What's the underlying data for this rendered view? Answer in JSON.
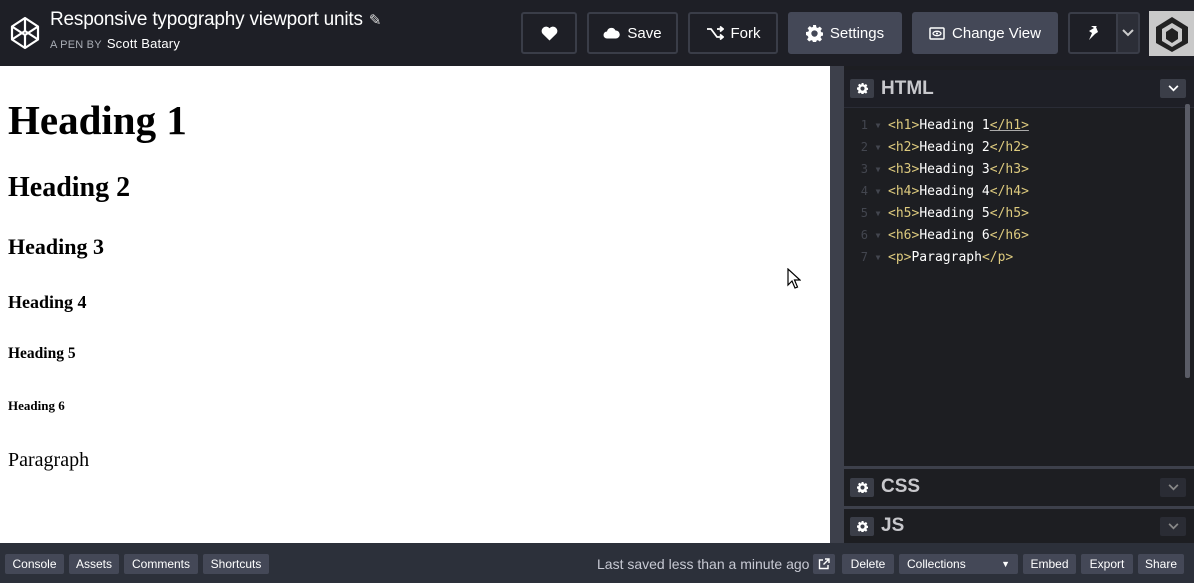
{
  "header": {
    "pen_title": "Responsive typography viewport units",
    "byline_prefix": "A PEN BY",
    "author": "Scott Batary",
    "buttons": {
      "save": "Save",
      "fork": "Fork",
      "settings": "Settings",
      "change_view": "Change View"
    }
  },
  "preview": {
    "h1": "Heading 1",
    "h2": "Heading 2",
    "h3": "Heading 3",
    "h4": "Heading 4",
    "h5": "Heading 5",
    "h6": "Heading 6",
    "p": "Paragraph"
  },
  "editors": {
    "html_label": "HTML",
    "css_label": "CSS",
    "js_label": "JS",
    "code_lines": [
      {
        "num": "1",
        "open": "<h1>",
        "text": "Heading 1",
        "close": "</h1>"
      },
      {
        "num": "2",
        "open": "<h2>",
        "text": "Heading 2",
        "close": "</h2>"
      },
      {
        "num": "3",
        "open": "<h3>",
        "text": "Heading 3",
        "close": "</h3>"
      },
      {
        "num": "4",
        "open": "<h4>",
        "text": "Heading 4",
        "close": "</h4>"
      },
      {
        "num": "5",
        "open": "<h5>",
        "text": "Heading 5",
        "close": "</h5>"
      },
      {
        "num": "6",
        "open": "<h6>",
        "text": "Heading 6",
        "close": "</h6>"
      },
      {
        "num": "7",
        "open": "<p>",
        "text": "Paragraph",
        "close": "</p>"
      }
    ]
  },
  "footer": {
    "console": "Console",
    "assets": "Assets",
    "comments": "Comments",
    "shortcuts": "Shortcuts",
    "saved_status": "Last saved less than a minute ago",
    "delete": "Delete",
    "collections": "Collections",
    "embed": "Embed",
    "export": "Export",
    "share": "Share"
  },
  "colors": {
    "header_bg": "#1e1f26",
    "button_fill": "#444857",
    "code_tag": "#ddca7e",
    "editor_bg": "#1d1e22",
    "footer_bg": "#2c303a"
  }
}
